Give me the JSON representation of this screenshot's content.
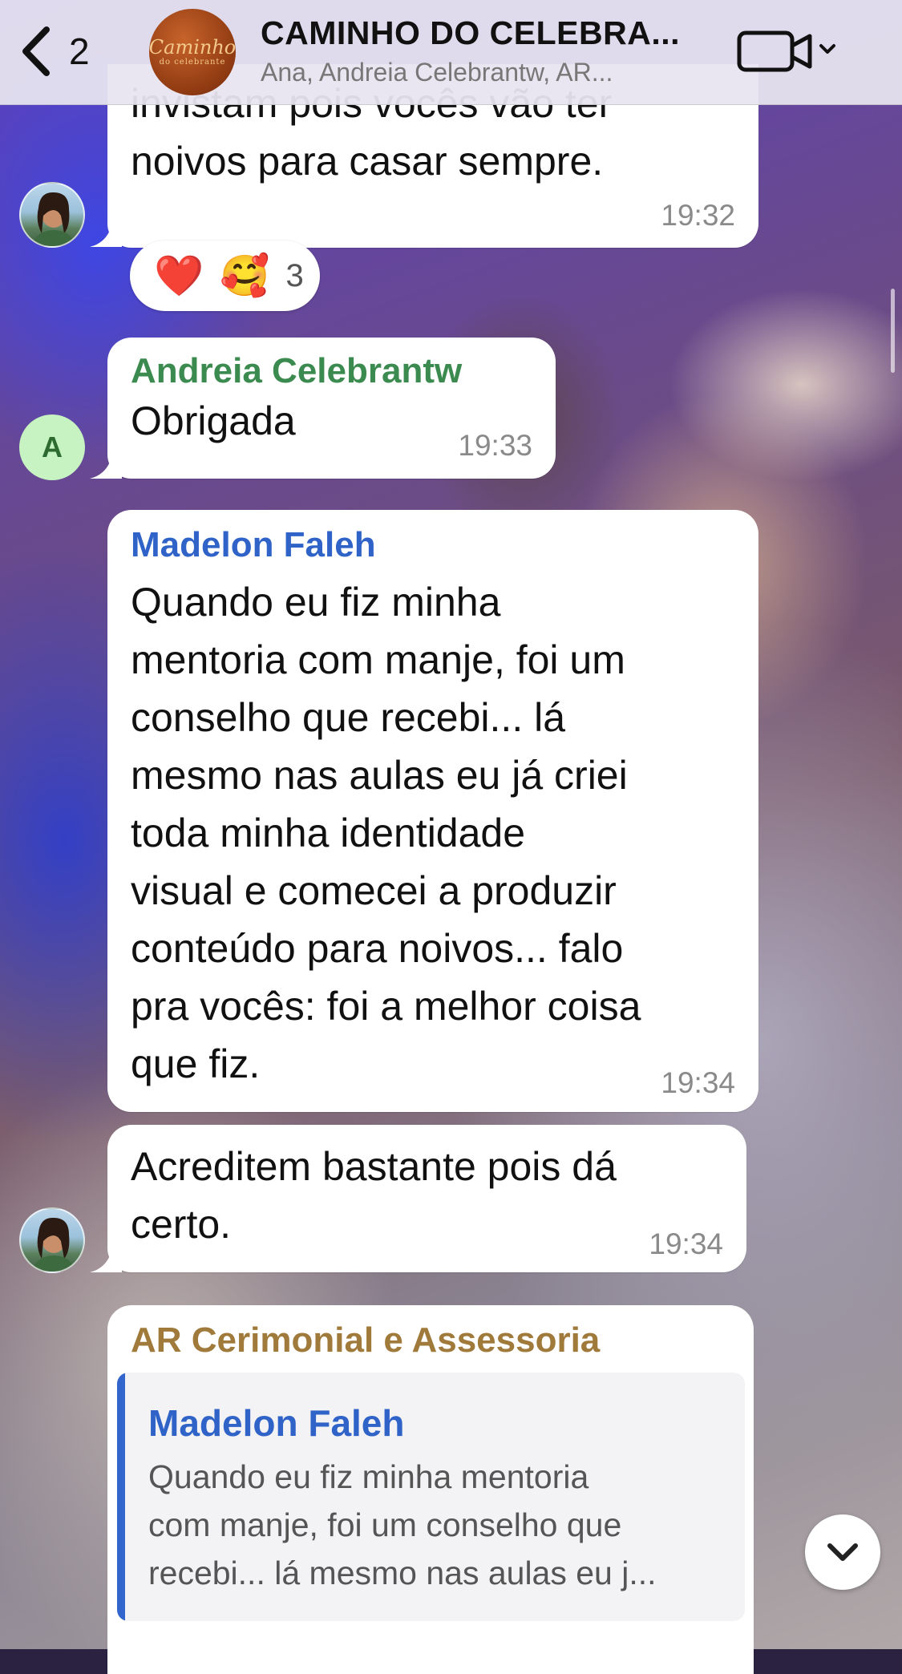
{
  "header": {
    "back_count": "2",
    "group_title": "CAMINHO DO CELEBRA...",
    "group_subtitle": "Ana, Andreia Celebrantw, AR...",
    "avatar_logo_text": "Caminho",
    "avatar_logo_sub": "do celebrante",
    "back_icon": "chevron-left-icon",
    "video_icon": "video-camera-icon"
  },
  "messages": [
    {
      "text_lines": [
        "invistam pois vocês vão ter",
        "noivos para casar sempre."
      ],
      "time": "19:32",
      "reactions": {
        "emojis": [
          "❤️",
          "🥰"
        ],
        "count": "3"
      }
    },
    {
      "sender": "Andreia Celebrantw",
      "sender_color": "#3b8a4f",
      "avatar_letter": "A",
      "text": "Obrigada",
      "time": "19:33"
    },
    {
      "sender": "Madelon Faleh",
      "sender_color": "#2f63c8",
      "text_lines": [
        "Quando eu fiz minha",
        "mentoria com manje, foi um",
        "conselho que recebi... lá",
        "mesmo nas aulas eu já criei",
        "toda minha identidade",
        "visual e comecei a produzir",
        "conteúdo para noivos... falo",
        "pra vocês: foi a melhor coisa",
        "que fiz."
      ],
      "time": "19:34"
    },
    {
      "text_lines": [
        "Acreditem bastante pois dá",
        "certo."
      ],
      "time": "19:34"
    },
    {
      "sender": "AR Cerimonial e Assessoria",
      "sender_color": "#a07a3a",
      "quote": {
        "sender": "Madelon Faleh",
        "text_lines": [
          "Quando eu fiz minha mentoria",
          "com manje, foi um conselho que",
          "recebi... lá mesmo nas aulas eu j..."
        ]
      }
    }
  ],
  "colors": {
    "header_bg": "#e8e4f0",
    "bubble_bg": "#ffffff",
    "quote_bar": "#3366cc",
    "time_text": "#8a8a8a"
  },
  "scroll_down_icon": "chevron-down-icon"
}
